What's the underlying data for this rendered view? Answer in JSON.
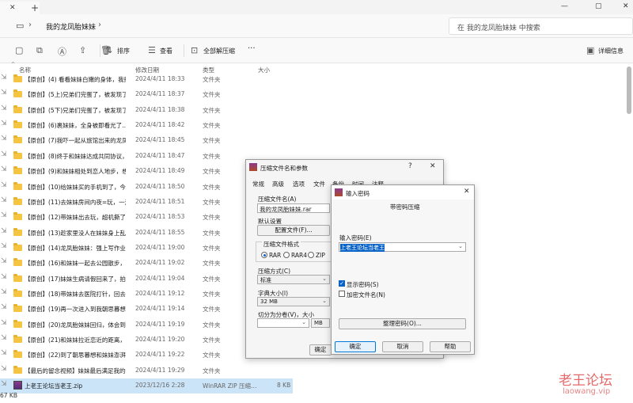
{
  "window": {
    "tab_close": "✕",
    "tab_add": "+",
    "min": "—",
    "max": "▢",
    "close": "✕"
  },
  "address": {
    "path": "我的龙凤胎妹妹",
    "search_placeholder": "在 我的龙凤胎妹妹 中搜索"
  },
  "toolbar": {
    "sort": "排序",
    "view": "查看",
    "extract_all": "全部解压缩",
    "more": "···",
    "details": "详细信息"
  },
  "columns": {
    "name": "名称",
    "date": "修改日期",
    "type": "类型",
    "size": "大小"
  },
  "files": [
    {
      "name": "【原创】(4) 看看妹妹白嫩的身体，我把…",
      "date": "2024/4/11 18:33",
      "type": "文件夹",
      "size": ""
    },
    {
      "name": "【原创】(5上)兄弟们完蛋了，被发现了…",
      "date": "2024/4/11 18:37",
      "type": "文件夹",
      "size": ""
    },
    {
      "name": "【原创】(5下)兄弟们完蛋了，被发现了…",
      "date": "2024/4/11 18:38",
      "type": "文件夹",
      "size": ""
    },
    {
      "name": "【原创】(6)裹妹妹，全身被即看光了…",
      "date": "2024/4/11 18:42",
      "type": "文件夹",
      "size": ""
    },
    {
      "name": "【原创】(7)我吓一起从旅馆出来的龙凤…",
      "date": "2024/4/11 18:45",
      "type": "文件夹",
      "size": ""
    },
    {
      "name": "【原创】(8)终于和妹妹达成共同协议，…",
      "date": "2024/4/11 18:47",
      "type": "文件夹",
      "size": ""
    },
    {
      "name": "【原创】(9)和妹妹相处到恋人地步，想…",
      "date": "2024/4/11 18:49",
      "type": "文件夹",
      "size": ""
    },
    {
      "name": "【原创】(10)给妹妹买的手机到了，今天…",
      "date": "2024/4/11 18:50",
      "type": "文件夹",
      "size": ""
    },
    {
      "name": "【原创】(11)去妹妹房间内夜=玩，一边…",
      "date": "2024/4/11 18:51",
      "type": "文件夹",
      "size": ""
    },
    {
      "name": "【原创】(12)带妹妹出去玩，超机撕了她…",
      "date": "2024/4/11 18:53",
      "type": "文件夹",
      "size": ""
    },
    {
      "name": "【原创】(13)趁家里没人在妹妹身上乱摸…",
      "date": "2024/4/11 18:55",
      "type": "文件夹",
      "size": ""
    },
    {
      "name": "【原创】(14)龙凤胎妹妹：强上写作业的…",
      "date": "2024/4/11 19:00",
      "type": "文件夹",
      "size": ""
    },
    {
      "name": "【原创】(16)和妹妹一起去公园散步，当…",
      "date": "2024/4/11 19:02",
      "type": "文件夹",
      "size": ""
    },
    {
      "name": "【原创】(17)妹妹生病请假回来了，拍了…",
      "date": "2024/4/11 19:04",
      "type": "文件夹",
      "size": ""
    },
    {
      "name": "【原创】(18)带妹妹去医院打针，回去…",
      "date": "2024/4/11 19:12",
      "type": "文件夹",
      "size": ""
    },
    {
      "name": "【原创】(19)再一次进入到我朝思暮想的…",
      "date": "2024/4/11 19:14",
      "type": "文件夹",
      "size": ""
    },
    {
      "name": "【原创】(20)龙凤胎妹妹回归，体会到了…",
      "date": "2024/4/11 19:19",
      "type": "文件夹",
      "size": ""
    },
    {
      "name": "【原创】(21)和妹妹拉近恋近的距离，让…",
      "date": "2024/4/11 19:20",
      "type": "文件夹",
      "size": ""
    },
    {
      "name": "【原创】(22)到了朝思暮想和妹妹澎湃的…",
      "date": "2024/4/11 19:22",
      "type": "文件夹",
      "size": ""
    },
    {
      "name": "【最后的留念视频】妹妹最后满足我的欲…",
      "date": "2024/4/11 19:29",
      "type": "文件夹",
      "size": ""
    },
    {
      "name": "上老王论坛当老王.zip",
      "date": "2023/12/16 2:28",
      "type": "WinRAR ZIP 压缩…",
      "size": "8 KB"
    }
  ],
  "status": "67 KB",
  "archive_dialog": {
    "title": "压缩文件名和参数",
    "help": "?",
    "close": "✕",
    "tabs": [
      "常规",
      "高级",
      "选项",
      "文件",
      "备份",
      "时间",
      "注释"
    ],
    "filename_label": "压缩文件名(A)",
    "filename_value": "我的龙凤胎妹妹.rar",
    "default_label": "默认设置",
    "profiles_btn": "配置文件(F)...",
    "format_label": "压缩文件格式",
    "formats": [
      "RAR",
      "RAR4",
      "ZIP"
    ],
    "method_label": "压缩方式(C)",
    "method_value": "标准",
    "dict_label": "字典大小(I)",
    "dict_value": "32 MB",
    "split_label": "切分为分卷(V)，大小",
    "split_unit": "MB",
    "ok": "确定"
  },
  "password_dialog": {
    "title": "输入密码",
    "close": "✕",
    "heading": "带密码压缩",
    "enter_label": "输入密码(E)",
    "password_value": "上老王论坛当老王",
    "show_password": "显示密码(S)",
    "encrypt_names": "加密文件名(N)",
    "organize_btn": "整理密码(O)...",
    "ok": "确定",
    "cancel": "取消",
    "help": "帮助"
  },
  "watermark": {
    "cn": "老王论坛",
    "en": "laowang.vip"
  }
}
